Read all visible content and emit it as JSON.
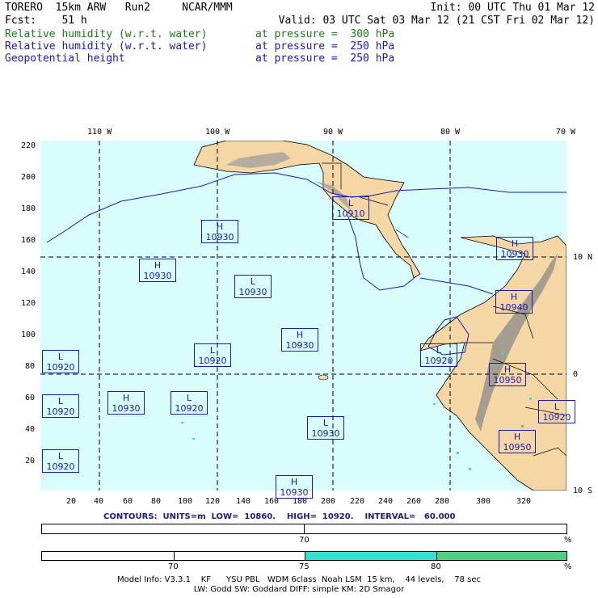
{
  "header": {
    "line1_left": "TORERO  15km ARW   Run2     NCAR/MMM",
    "line1_right": "Init: 00 UTC Thu 01 Mar 12",
    "line2_left": "Fcst:    51 h",
    "line2_right": "Valid: 03 UTC Sat 03 Mar 12 (21 CST Fri 02 Mar 12)",
    "fields": [
      {
        "name": "Relative humidity (w.r.t. water)",
        "pressure": "at pressure =  300 hPa",
        "color": "#1a7a1a"
      },
      {
        "name": "Relative humidity (w.r.t. water)",
        "pressure": "at pressure =  250 hPa",
        "color": "#1a1ab0"
      },
      {
        "name": "Geopotential height",
        "pressure": "at pressure =  250 hPa",
        "color": "#1a1ab0"
      }
    ]
  },
  "map": {
    "lon_labels": [
      "110 W",
      "100 W",
      "90 W",
      "80 W",
      "70 W"
    ],
    "lat_labels_right": [
      "10 N",
      "0",
      "10 S"
    ],
    "y_axis_ticks": [
      "220",
      "200",
      "180",
      "160",
      "140",
      "120",
      "100",
      "80",
      "60",
      "40",
      "20"
    ],
    "x_axis_ticks": [
      "20",
      "40",
      "60",
      "80",
      "100",
      "120",
      "140",
      "160",
      "180",
      "200",
      "220",
      "240",
      "260",
      "280",
      "300",
      "320"
    ],
    "centers": [
      {
        "type": "H",
        "value": "10930"
      },
      {
        "type": "L",
        "value": "10910"
      },
      {
        "type": "H",
        "value": "10930"
      },
      {
        "type": "L",
        "value": "10930"
      },
      {
        "type": "H",
        "value": "10930"
      },
      {
        "type": "H",
        "value": "10940"
      },
      {
        "type": "H",
        "value": "10930"
      },
      {
        "type": "L",
        "value": "10920"
      },
      {
        "type": "L",
        "value": "10920"
      },
      {
        "type": "L",
        "value": "10920"
      },
      {
        "type": "H",
        "value": "10950"
      },
      {
        "type": "L",
        "value": "10920"
      },
      {
        "type": "H",
        "value": "10930"
      },
      {
        "type": "L",
        "value": "10920"
      },
      {
        "type": "L",
        "value": "10930"
      },
      {
        "type": "H",
        "value": "10950"
      },
      {
        "type": "L",
        "value": "10920"
      },
      {
        "type": "H",
        "value": "10930"
      },
      {
        "type": "L",
        "value": "10920"
      }
    ]
  },
  "contours": {
    "text": "CONTOURS:  UNITS=m  LOW=  10860.    HIGH=  10920.    INTERVAL=   60.000"
  },
  "legend_bar1": {
    "labels": [
      "70",
      "%"
    ]
  },
  "legend_bar2": {
    "labels": [
      "70",
      "75",
      "80",
      "%"
    ],
    "colors": [
      "#ffffff",
      "#ffffff",
      "#33e0d0",
      "#50d080"
    ]
  },
  "footer": {
    "line1": "Model Info: V3.3.1    KF      YSU PBL   WDM 6class  Noah LSM  15 km,    44 levels,    78 sec",
    "line2": "LW: Godd SW: Goddard DIFF: simple KM: 2D Smagor"
  },
  "colors": {
    "ocean": "#d9fcfc",
    "land": "#f5d6a5",
    "terrain": "#999999",
    "contour": "#1a1ab0",
    "grid": "#000000"
  }
}
